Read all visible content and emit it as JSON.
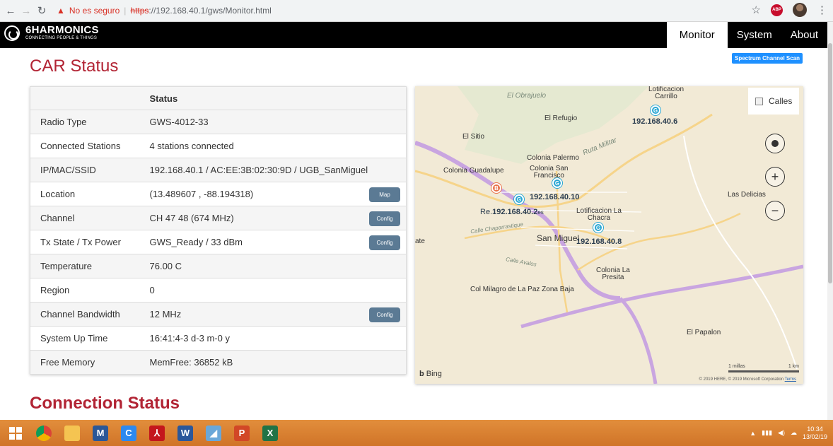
{
  "browser": {
    "security_label": "No es seguro",
    "url_protocol": "https",
    "url_rest": "://192.168.40.1/gws/Monitor.html"
  },
  "header": {
    "brand_name": "6HARMONICS",
    "brand_tagline": "CONNECTING PEOPLE & THINGS",
    "nav": [
      "Monitor",
      "System",
      "About"
    ],
    "active_nav": "Monitor",
    "spectrum_button": "Spectrum Channel Scan"
  },
  "page": {
    "title": "CAR Status",
    "next_section": "Connection Status"
  },
  "status_table": {
    "column_header": "Status",
    "rows": [
      {
        "label": "Radio Type",
        "value": "GWS-4012-33",
        "button": ""
      },
      {
        "label": "Connected Stations",
        "value": "4 stations connected",
        "button": ""
      },
      {
        "label": "IP/MAC/SSID",
        "value": "192.168.40.1 / AC:EE:3B:02:30:9D / UGB_SanMiguel",
        "button": ""
      },
      {
        "label": "Location",
        "value": "(13.489607 , -88.194318)",
        "button": "Map"
      },
      {
        "label": "Channel",
        "value": "CH 47 48 (674 MHz)",
        "button": "Config"
      },
      {
        "label": "Tx State / Tx Power",
        "value": "GWS_Ready / 33 dBm",
        "button": "Config"
      },
      {
        "label": "Temperature",
        "value": "76.00 C",
        "button": ""
      },
      {
        "label": "Region",
        "value": "0",
        "button": ""
      },
      {
        "label": "Channel Bandwidth",
        "value": "12 MHz",
        "button": "Config"
      },
      {
        "label": "System Up Time",
        "value": "16:41:4-3 d-3 m-0 y",
        "button": ""
      },
      {
        "label": "Free Memory",
        "value": "MemFree: 36852 kB",
        "button": ""
      }
    ]
  },
  "map": {
    "layer_label": "Calles",
    "places": [
      {
        "name": "Lotificacion Carrillo",
        "line1": "Lotificacion",
        "line2": "Carrillo"
      },
      {
        "name": "El Obrajuelo"
      },
      {
        "name": "El Refugio"
      },
      {
        "name": "El Sitio"
      },
      {
        "name": "Colonia Palermo"
      },
      {
        "name": "Ruta Militar"
      },
      {
        "name": "Colonia Guadalupe"
      },
      {
        "name": "Colonia San Francisco",
        "line1": "Colonia San",
        "line2": "Francisco"
      },
      {
        "name": "Las Delicias"
      },
      {
        "name": "Lotificacion La Chacra",
        "line1": "Lotificacion La",
        "line2": "Chacra"
      },
      {
        "name": "Calle Chaparrastique"
      },
      {
        "name": "San Miguel"
      },
      {
        "name": "ate"
      },
      {
        "name": "Calle Avalos"
      },
      {
        "name": "Colonia La Presita",
        "line1": "Colonia La",
        "line2": "Presita"
      },
      {
        "name": "Col Milagro de La Paz Zona Baja"
      },
      {
        "name": "El Papalon"
      }
    ],
    "stations": [
      "192.168.40.6",
      "192.168.40.10",
      "192.168.40.2",
      "192.168.40.8"
    ],
    "station_prefix": "Re.",
    "station_suffix": "es",
    "provider": "Bing",
    "scale_miles": "1 millas",
    "scale_km": "1 km",
    "copyright": "© 2019 HERE, © 2019 Microsoft Corporation",
    "terms": "Terms"
  },
  "taskbar": {
    "time": "10:34",
    "date": "13/02/19"
  },
  "colors": {
    "title_red": "#b22434",
    "button_slate": "#5b7a94",
    "spectrum_blue": "#1e90ff",
    "taskbar_orange": "#d98232"
  }
}
